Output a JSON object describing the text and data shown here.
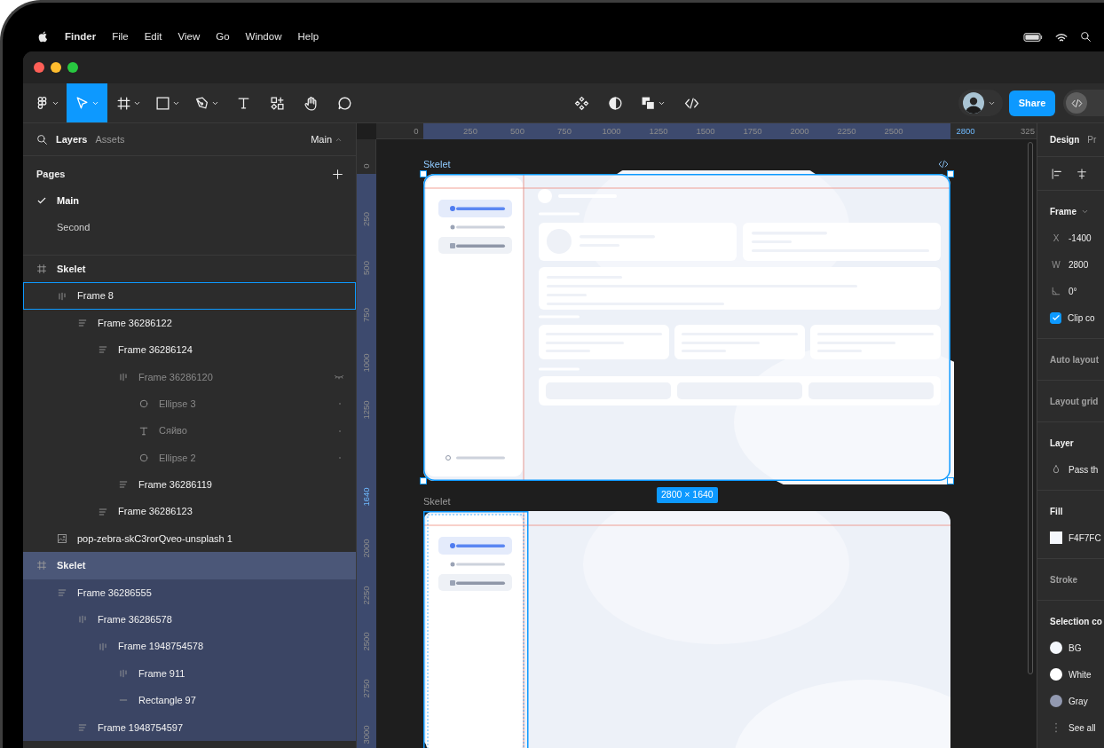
{
  "menu_bar": {
    "app": "Finder",
    "items": [
      "File",
      "Edit",
      "View",
      "Go",
      "Window",
      "Help"
    ]
  },
  "toolbar": {
    "tools": [
      {
        "kind": "main-menu",
        "selected": false,
        "caret": true
      },
      {
        "kind": "move",
        "selected": true,
        "caret": true
      },
      {
        "kind": "frame",
        "selected": false,
        "caret": true
      },
      {
        "kind": "shape",
        "selected": false,
        "caret": true
      },
      {
        "kind": "pen",
        "selected": false,
        "caret": true
      },
      {
        "kind": "text",
        "selected": false,
        "caret": false
      },
      {
        "kind": "resources",
        "selected": false,
        "caret": false
      },
      {
        "kind": "hand",
        "selected": false,
        "caret": false
      },
      {
        "kind": "comment",
        "selected": false,
        "caret": false
      }
    ],
    "center_tools": [
      {
        "kind": "component",
        "caret": false
      },
      {
        "kind": "contrast",
        "caret": false
      },
      {
        "kind": "boolean",
        "caret": true
      },
      {
        "kind": "code",
        "caret": false
      }
    ],
    "share": "Share",
    "dev_mode": {
      "on": false
    }
  },
  "left_panel": {
    "tabs": [
      {
        "label": "Layers",
        "selected": true
      },
      {
        "label": "Assets",
        "selected": false
      }
    ],
    "page_switch": "Main",
    "pages_title": "Pages",
    "pages": [
      {
        "label": "Main",
        "selected": true
      },
      {
        "label": "Second",
        "selected": false
      }
    ],
    "layers": [
      {
        "name": "Skelet",
        "kind": "frame",
        "selected": false,
        "hovered": false,
        "hidden": false,
        "children": [
          {
            "name": "Frame 8",
            "kind": "hstack",
            "selected": false,
            "hovered": true,
            "hidden": false,
            "children": [
              {
                "name": "Frame 36286122",
                "kind": "vstack",
                "selected": false,
                "hovered": false,
                "hidden": false,
                "children": [
                  {
                    "name": "Frame 36286124",
                    "kind": "vstack",
                    "selected": false,
                    "hovered": false,
                    "hidden": false,
                    "children": [
                      {
                        "name": "Frame 36286120",
                        "kind": "hstack",
                        "selected": false,
                        "hovered": false,
                        "hidden": true,
                        "children": [
                          {
                            "name": "Ellipse 3",
                            "kind": "ellipse",
                            "selected": false,
                            "hovered": false,
                            "hidden": false
                          },
                          {
                            "name": "Сяйво",
                            "kind": "text",
                            "selected": false,
                            "hovered": false,
                            "hidden": false
                          },
                          {
                            "name": "Ellipse 2",
                            "kind": "ellipse",
                            "selected": false,
                            "hovered": false,
                            "hidden": false
                          }
                        ]
                      },
                      {
                        "name": "Frame 36286119",
                        "kind": "vstack",
                        "selected": false,
                        "hovered": false,
                        "hidden": false
                      }
                    ]
                  },
                  {
                    "name": "Frame 36286123",
                    "kind": "vstack",
                    "selected": false,
                    "hovered": false,
                    "hidden": false
                  }
                ]
              }
            ]
          },
          {
            "name": "pop-zebra-skC3rorQveo-unsplash 1",
            "kind": "image",
            "selected": false,
            "hovered": false,
            "hidden": false
          }
        ]
      },
      {
        "name": "Skelet",
        "kind": "frame",
        "selected": true,
        "hovered": false,
        "hidden": false,
        "children": [
          {
            "name": "Frame 36286555",
            "kind": "vstack",
            "selected": true,
            "hovered": false,
            "hidden": false,
            "children": [
              {
                "name": "Frame 36286578",
                "kind": "hstack",
                "selected": true,
                "hovered": false,
                "hidden": false,
                "children": [
                  {
                    "name": "Frame 1948754578",
                    "kind": "hstack",
                    "selected": true,
                    "hovered": false,
                    "hidden": false,
                    "children": [
                      {
                        "name": "Frame 911",
                        "kind": "hstack",
                        "selected": true,
                        "hovered": false,
                        "hidden": false
                      },
                      {
                        "name": "Rectangle 97",
                        "kind": "line",
                        "selected": true,
                        "hovered": false,
                        "hidden": false
                      }
                    ]
                  }
                ]
              },
              {
                "name": "Frame 1948754597",
                "kind": "vstack",
                "selected": true,
                "hovered": false,
                "hidden": false
              }
            ]
          }
        ]
      }
    ]
  },
  "rulers": {
    "top": [
      {
        "label": "0",
        "highlighted": false
      },
      {
        "label": "250",
        "highlighted": false
      },
      {
        "label": "500",
        "highlighted": false
      },
      {
        "label": "750",
        "highlighted": false
      },
      {
        "label": "1000",
        "highlighted": false
      },
      {
        "label": "1250",
        "highlighted": false
      },
      {
        "label": "1500",
        "highlighted": false
      },
      {
        "label": "1750",
        "highlighted": false
      },
      {
        "label": "2000",
        "highlighted": false
      },
      {
        "label": "2250",
        "highlighted": false
      },
      {
        "label": "2500",
        "highlighted": false
      },
      {
        "label": "2800",
        "highlighted": true
      },
      {
        "label": "325",
        "highlighted": false
      }
    ],
    "left": [
      {
        "label": "0",
        "highlighted": false
      },
      {
        "label": "250",
        "highlighted": false
      },
      {
        "label": "500",
        "highlighted": false
      },
      {
        "label": "750",
        "highlighted": false
      },
      {
        "label": "1000",
        "highlighted": false
      },
      {
        "label": "1250",
        "highlighted": false
      },
      {
        "label": "1640",
        "highlighted": true
      },
      {
        "label": "2000",
        "highlighted": false
      },
      {
        "label": "2250",
        "highlighted": false
      },
      {
        "label": "2500",
        "highlighted": false
      },
      {
        "label": "2750",
        "highlighted": false
      },
      {
        "label": "3000",
        "highlighted": false
      }
    ]
  },
  "frames": [
    {
      "label": "Skelet",
      "selected": true,
      "kind": "dashboard",
      "code_icon": true,
      "size_badge": "2800 × 1640"
    },
    {
      "label": "Skelet",
      "selected": false,
      "kind": "sidebar-selected",
      "code_icon": false
    }
  ],
  "design_panel": {
    "tabs": [
      {
        "label": "Design",
        "selected": true
      },
      {
        "label": "Pr",
        "selected": false
      }
    ],
    "sections": [
      {
        "kind": "align"
      },
      {
        "kind": "properties",
        "title": "Frame",
        "active": true,
        "dropdown": true,
        "fields": [
          {
            "kind": "field",
            "label": "X",
            "value": "-1400"
          },
          {
            "kind": "field",
            "label": "W",
            "value": "2800"
          },
          {
            "kind": "angle",
            "value": "0°"
          },
          {
            "kind": "checkbox",
            "label": "Clip co",
            "checked": true
          }
        ]
      },
      {
        "kind": "properties",
        "title": "Auto layout",
        "active": false,
        "dropdown": false
      },
      {
        "kind": "properties",
        "title": "Layout grid",
        "active": false,
        "dropdown": false
      },
      {
        "kind": "properties",
        "title": "Layer",
        "active": true,
        "dropdown": false,
        "fields": [
          {
            "kind": "blend",
            "value": "Pass th"
          }
        ]
      },
      {
        "kind": "properties",
        "title": "Fill",
        "active": true,
        "dropdown": false,
        "fields": [
          {
            "kind": "swatch",
            "color": "#f4f7fc",
            "value": "F4F7FC"
          }
        ]
      },
      {
        "kind": "properties",
        "title": "Stroke",
        "active": false,
        "dropdown": false
      },
      {
        "kind": "properties",
        "title": "Selection co",
        "active": true,
        "dropdown": false,
        "fields": [
          {
            "kind": "color",
            "color": "#f4f7fc",
            "value": "BG"
          },
          {
            "kind": "color",
            "color": "#ffffff",
            "value": "White"
          },
          {
            "kind": "color",
            "color": "#9299b0",
            "value": "Gray"
          },
          {
            "kind": "more",
            "value": "See all"
          }
        ]
      }
    ]
  }
}
